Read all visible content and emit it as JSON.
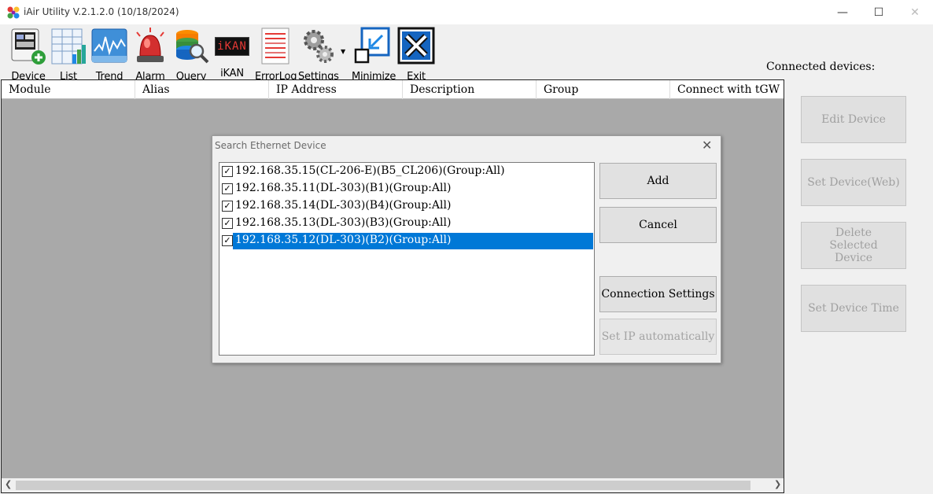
{
  "window": {
    "title": "iAir Utility V.2.1.2.0 (10/18/2024)",
    "minimize_glyph": "—",
    "maximize_glyph": "☐",
    "close_glyph": "✕"
  },
  "toolbar": {
    "items": [
      {
        "label": "Device",
        "icon": "device-add-icon"
      },
      {
        "label": "List",
        "icon": "list-icon"
      },
      {
        "label": "Trend",
        "icon": "trend-icon"
      },
      {
        "label": "Alarm",
        "icon": "alarm-icon"
      },
      {
        "label": "Query",
        "icon": "query-icon"
      },
      {
        "label": "iKAN",
        "icon": "ikan-icon"
      },
      {
        "label": "ErrorLog",
        "icon": "errorlog-icon"
      },
      {
        "label": "Settings",
        "icon": "settings-icon"
      },
      {
        "label": "Minimize",
        "icon": "minimize-icon"
      },
      {
        "label": "Exit",
        "icon": "exit-icon"
      }
    ],
    "ikan_badge": "iKAN"
  },
  "grid": {
    "columns": [
      "Module",
      "Alias",
      "IP Address",
      "Description",
      "Group",
      "Connect with tGW"
    ]
  },
  "side_panel": {
    "heading": "Connected devices:",
    "buttons": [
      "Edit Device",
      "Set Device(Web)",
      "Delete Selected Device",
      "Set Device Time"
    ]
  },
  "dialog": {
    "title": "Search Ethernet Device",
    "close_glyph": "✕",
    "items": [
      {
        "text": "192.168.35.15(CL-206-E)(B5_CL206)(Group:All)",
        "checked": true,
        "selected": false
      },
      {
        "text": "192.168.35.11(DL-303)(B1)(Group:All)",
        "checked": true,
        "selected": false
      },
      {
        "text": "192.168.35.14(DL-303)(B4)(Group:All)",
        "checked": true,
        "selected": false
      },
      {
        "text": "192.168.35.13(DL-303)(B3)(Group:All)",
        "checked": true,
        "selected": false
      },
      {
        "text": "192.168.35.12(DL-303)(B2)(Group:All)",
        "checked": true,
        "selected": true
      }
    ],
    "check_glyph": "✓",
    "buttons": {
      "add": "Add",
      "cancel": "Cancel",
      "connection_settings": "Connection Settings",
      "set_ip": "Set IP automatically"
    }
  },
  "colors": {
    "selection": "#0078d7",
    "workspace": "#a9a9a9",
    "disabled_text": "#a0a0a0"
  }
}
